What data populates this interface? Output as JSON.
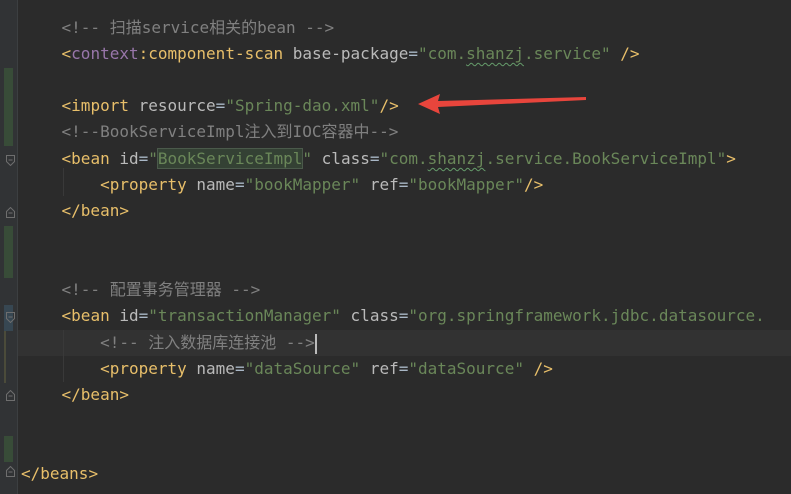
{
  "editor": {
    "lines": [
      {
        "comment": "<!-- 扫描service相关的bean -->"
      },
      {
        "open": "<",
        "ns": "context",
        "colon": ":",
        "tag": "component-scan",
        "attr1": "base-package",
        "eq1": "=",
        "val1_pre": "\"com.",
        "val1_typo": "shanzj",
        "val1_post": ".service\"",
        "close": " />"
      },
      {},
      {
        "open": "<",
        "tag": "import",
        "attr1": "resource",
        "eq1": "=",
        "val1": "\"Spring-dao.xml\"",
        "close": "/>"
      },
      {
        "comment": "<!--BookServiceImpl注入到IOC容器中-->"
      },
      {
        "open": "<",
        "tag": "bean",
        "attr1": "id",
        "eq1": "=",
        "val1_q1": "\"",
        "val1_hl": "BookServiceImpl",
        "val1_q2": "\"",
        "attr2": "class",
        "eq2": "=",
        "val2_pre": "\"com.",
        "val2_typo": "shanzj",
        "val2_post": ".service.BookServiceImpl\"",
        "close": ">"
      },
      {
        "open": "<",
        "tag": "property",
        "attr1": "name",
        "eq1": "=",
        "val1": "\"bookMapper\"",
        "attr2": "ref",
        "eq2": "=",
        "val2": "\"bookMapper\"",
        "close": "/>"
      },
      {
        "open": "</",
        "tag": "bean",
        "close": ">"
      },
      {},
      {},
      {
        "comment": "<!-- 配置事务管理器 -->"
      },
      {
        "open": "<",
        "tag": "bean",
        "attr1": "id",
        "eq1": "=",
        "val1": "\"transactionManager\"",
        "attr2": "class",
        "eq2": "=",
        "val2": "\"org.springframework.jdbc.datasource."
      },
      {
        "comment": "<!-- 注入数据库连接池 -->"
      },
      {
        "open": "<",
        "tag": "property",
        "attr1": "name",
        "eq1": "=",
        "val1": "\"dataSource\"",
        "attr2": "ref",
        "eq2": "=",
        "val2": "\"dataSource\"",
        "close": " />"
      },
      {
        "open": "</",
        "tag": "bean",
        "close": ">"
      },
      {},
      {},
      {
        "open": "</",
        "tag": "beans",
        "close": ">"
      }
    ]
  },
  "annotation": {
    "arrow_color": "#e8453c",
    "arrow_icon": "red-arrow-icon"
  },
  "colors": {
    "background": "#2b2b2b",
    "comment": "#808080",
    "tag": "#e8bf6a",
    "namespace": "#9876aa",
    "attribute": "#bababa",
    "value": "#6a8759"
  }
}
